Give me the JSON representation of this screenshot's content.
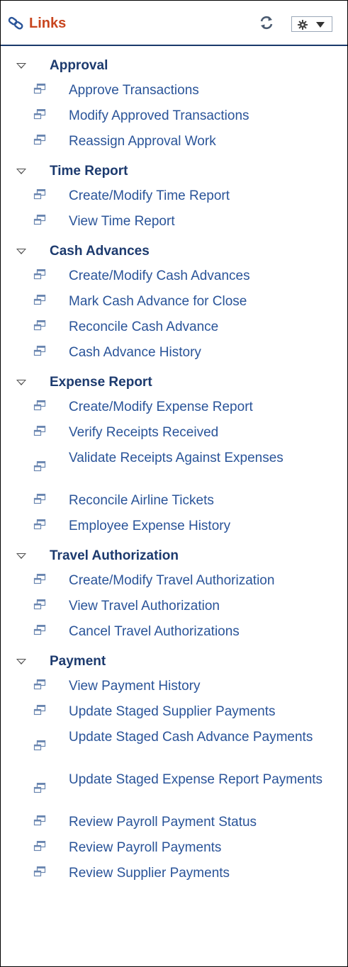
{
  "header": {
    "title": "Links",
    "refresh_icon": "refresh-icon",
    "options_icon": "gear-icon"
  },
  "groups": [
    {
      "title": "Approval",
      "items": [
        "Approve Transactions",
        "Modify Approved Transactions",
        "Reassign Approval Work"
      ]
    },
    {
      "title": "Time Report",
      "items": [
        "Create/Modify Time Report",
        "View Time Report"
      ]
    },
    {
      "title": "Cash Advances",
      "items": [
        "Create/Modify Cash Advances",
        "Mark Cash Advance for Close",
        "Reconcile Cash Advance",
        "Cash Advance History"
      ]
    },
    {
      "title": "Expense Report",
      "items": [
        "Create/Modify Expense Report",
        "Verify Receipts Received",
        "Validate Receipts Against Expenses",
        "Reconcile Airline Tickets",
        "Employee Expense History"
      ]
    },
    {
      "title": "Travel Authorization",
      "items": [
        "Create/Modify Travel Authorization",
        "View Travel Authorization",
        "Cancel Travel Authorizations"
      ]
    },
    {
      "title": "Payment",
      "items": [
        "View Payment History",
        "Update Staged Supplier Payments",
        "Update Staged Cash Advance Payments",
        "Update Staged Expense Report Payments",
        "Review Payroll Payment Status",
        "Review Payroll Payments",
        "Review Supplier Payments"
      ]
    }
  ],
  "colors": {
    "title": "#c8451e",
    "group_title": "#1c3a6e",
    "link": "#2a5499",
    "header_rule": "#1a3a6b"
  }
}
